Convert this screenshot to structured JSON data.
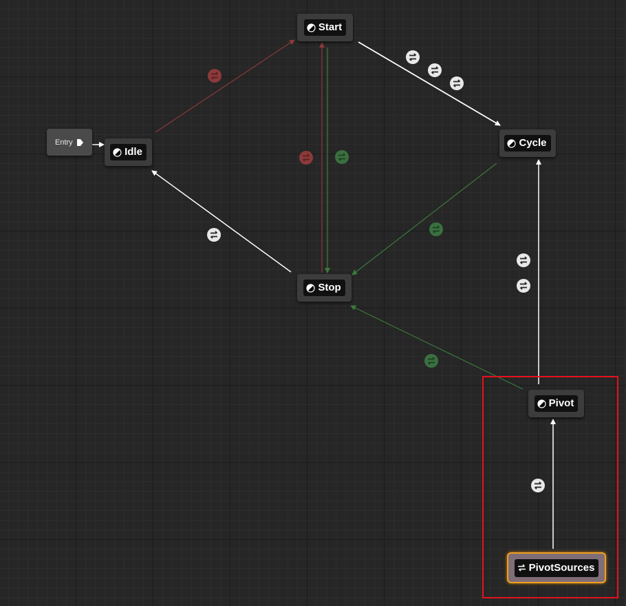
{
  "graph": {
    "entry": {
      "label": "Entry"
    },
    "nodes": {
      "start": {
        "label": "Start"
      },
      "idle": {
        "label": "Idle"
      },
      "cycle": {
        "label": "Cycle"
      },
      "stop": {
        "label": "Stop"
      },
      "pivot": {
        "label": "Pivot"
      },
      "pivot_sources": {
        "label": "PivotSources"
      }
    }
  },
  "colors": {
    "wire_white": "#ffffff",
    "wire_red": "#8a3a3a",
    "wire_green": "#3c7a3c",
    "icon_white": "#e8e8e8",
    "icon_red": "#8c3a3a",
    "icon_green": "#3a7040",
    "selection_outline": "#e8111c",
    "selected_node_border": "#f0a020"
  },
  "icons": {
    "state_node": "state-icon",
    "conduit_node": "conduit-icon",
    "transition_rule": "transition-rule-icon",
    "entry_pin": "exec-pin-icon"
  }
}
